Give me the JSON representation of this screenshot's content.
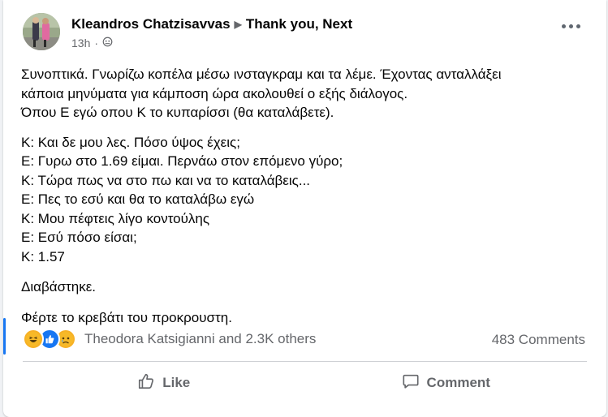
{
  "post": {
    "author": "Kleandros Chatzisavvas",
    "group": "Thank you, Next",
    "time": "13h",
    "paragraphs": [
      [
        "Συνοπτικά. Γνωρίζω κοπέλα μέσω ινσταγκραμ και τα λέμε. Έχοντας ανταλλάξει",
        "κάποια μηνύματα για κάμποση ώρα ακολουθεί ο εξής διάλογος.",
        "Όπου Ε εγώ οπου Κ το κυπαρίσσι (θα καταλάβετε)."
      ],
      [
        "Κ: Και δε μου λες. Πόσο ύψος έχεις;",
        "Ε: Γυρω στο 1.69 είμαι. Περνάω στον επόμενο γύρο;",
        "Κ: Τώρα πως να στο πω και να το καταλάβεις...",
        "Ε: Πες το εσύ και θα το καταλάβω εγώ",
        "Κ: Μου πέφτεις λίγο κοντούλης",
        "Ε: Εσύ πόσο είσαι;",
        "Κ: 1.57"
      ],
      [
        "Διαβάστηκε."
      ],
      [
        "Φέρτε το κρεβάτι του προκρουστη."
      ]
    ],
    "reactions": {
      "icons": [
        "haha-icon",
        "like-icon",
        "sad-icon"
      ],
      "summary": "Theodora Katsigianni and 2.3K others"
    },
    "comments_count": "483 Comments"
  },
  "actions": {
    "like_label": "Like",
    "comment_label": "Comment"
  },
  "colors": {
    "accent": "#1877f2",
    "text": "#050505",
    "secondary": "#65676b"
  }
}
